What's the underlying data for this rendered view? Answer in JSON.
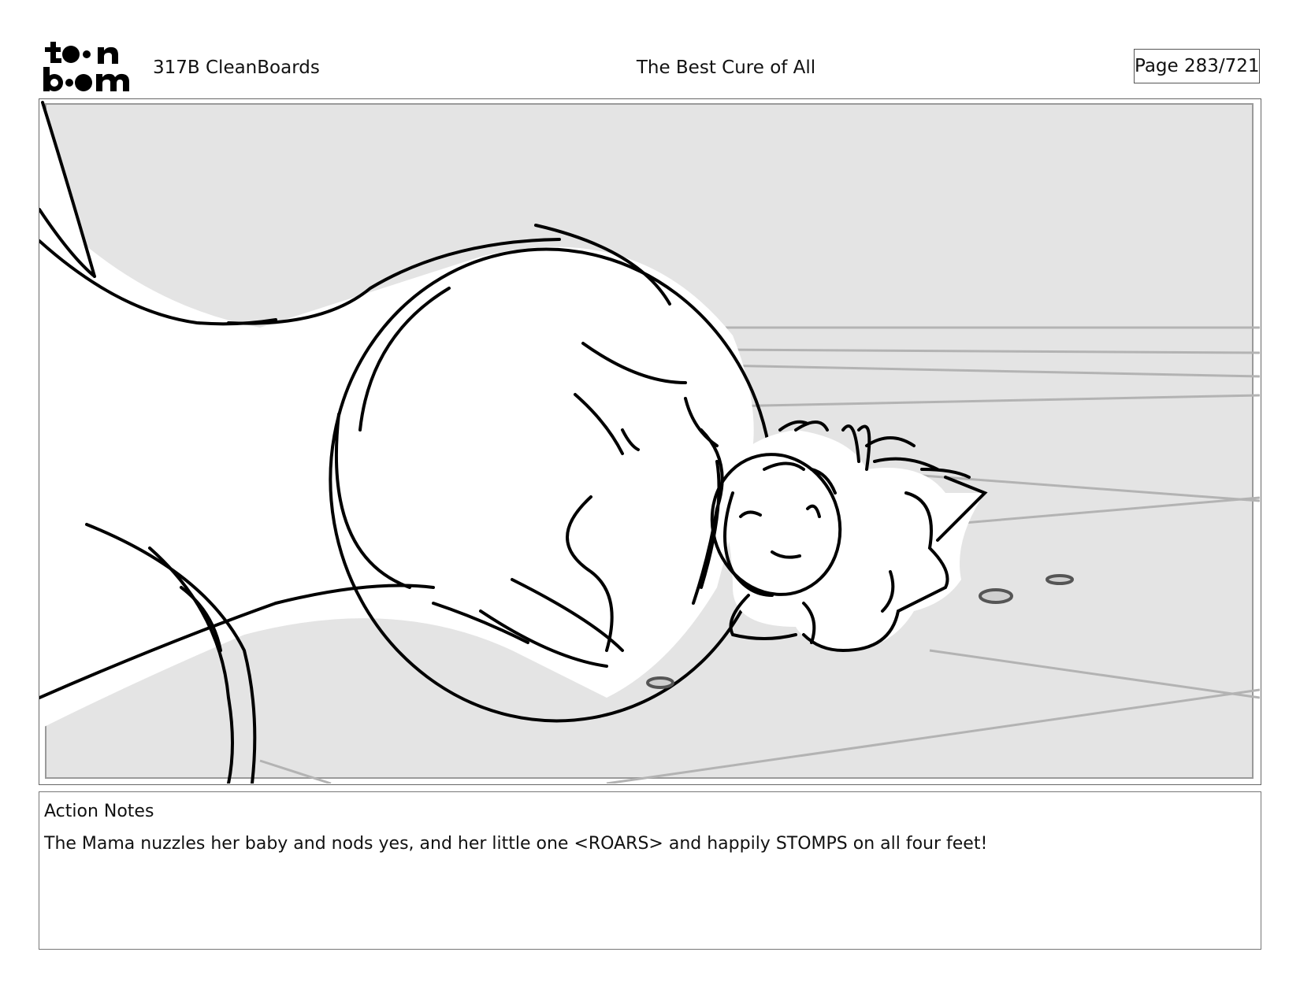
{
  "header": {
    "logo_text": "toon boom",
    "episode": "317B  CleanBoards",
    "title": "The Best Cure of All",
    "page": "Page 283/721"
  },
  "panel": {
    "background_color": "#e4e4e4",
    "ink_color": "#000000",
    "guide_color": "#aaaaaa"
  },
  "notes": {
    "label": "Action Notes",
    "text": "The Mama nuzzles her baby and nods yes, and her little one <ROARS> and happily STOMPS on all four feet!"
  }
}
